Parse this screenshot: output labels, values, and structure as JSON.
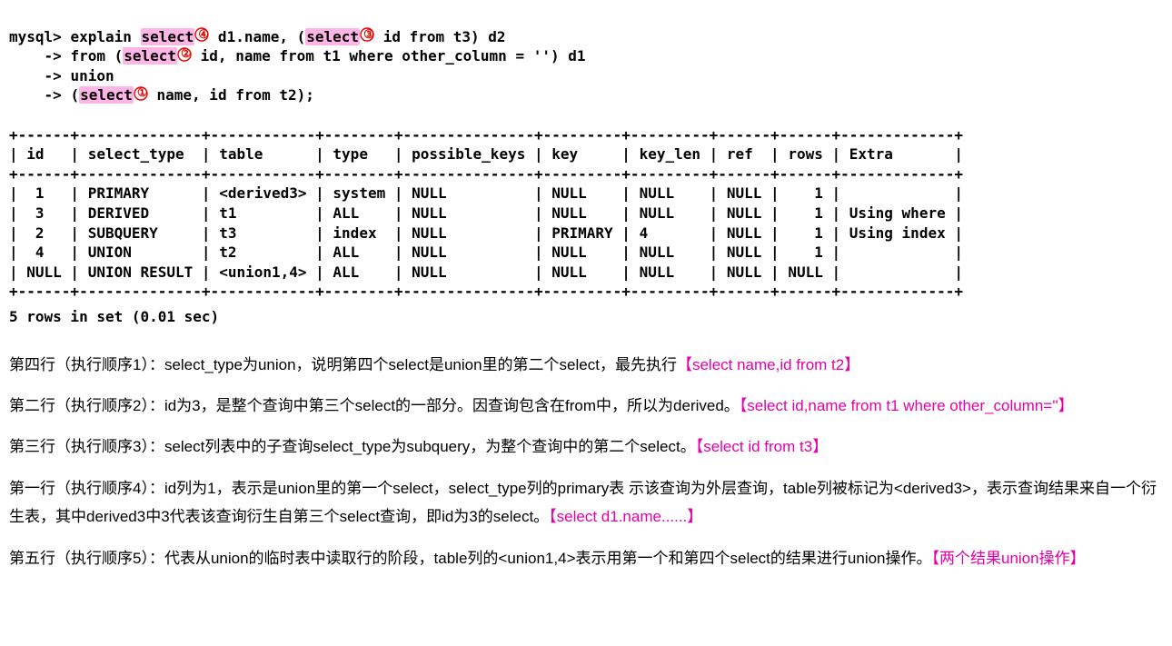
{
  "sql": {
    "prompt": "mysql> ",
    "l1a": "explain ",
    "l1_sel1": "select",
    "l1b": " d1.name, (",
    "l1_sel2": "select",
    "l1c": " id from t3) d2",
    "cont": "    -> ",
    "l2a": "from (",
    "l2_sel": "select",
    "l2b": " id, name from t1 where other_column = '') d1",
    "l3": "union",
    "l4a": "(",
    "l4_sel": "select",
    "l4b": " name, id from t2);",
    "ann4": "④",
    "ann3": "③",
    "ann2": "②",
    "ann1": "①"
  },
  "table": {
    "border_top": "+------+--------------+------------+--------+---------------+---------+---------+------+------+-------------+",
    "header": "| id   | select_type  | table      | type   | possible_keys | key     | key_len | ref  | rows | Extra       |",
    "border_mid": "+------+--------------+------------+--------+---------------+---------+---------+------+------+-------------+",
    "row1": "|  1   | PRIMARY      | <derived3> | system | NULL          | NULL    | NULL    | NULL |    1 |             |",
    "row2": "|  3   | DERIVED      | t1         | ALL    | NULL          | NULL    | NULL    | NULL |    1 | Using where |",
    "row3": "|  2   | SUBQUERY     | t3         | index  | NULL          | PRIMARY | 4       | NULL |    1 | Using index |",
    "row4": "|  4   | UNION        | t2         | ALL    | NULL          | NULL    | NULL    | NULL |    1 |             |",
    "row5": "| NULL | UNION RESULT | <union1,4> | ALL    | NULL          | NULL    | NULL    | NULL | NULL |             |",
    "border_bot": "+------+--------------+------------+--------+---------------+---------+---------+------+------+-------------+",
    "footer": "5 rows in set (0.01 sec)"
  },
  "exp": {
    "p1a": "第四行（执行顺序1）：select_type为union，说明第四个select是union里的第二个select，最先执行",
    "p1m": "【select name,id from t2】",
    "p2a": "第二行（执行顺序2）：id为3，是整个查询中第三个select的一部分。因查询包含在from中，所以为derived。",
    "p2m": "【select id,name from t1 where other_column=''】",
    "p3a": "第三行（执行顺序3）：select列表中的子查询select_type为subquery，为整个查询中的第二个select。",
    "p3m": "【select id from t3】",
    "p4a": "第一行（执行顺序4）：id列为1，表示是union里的第一个select，select_type列的primary表 示该查询为外层查询，table列被标记为<derived3>，表示查询结果来自一个衍生表，其中derived3中3代表该查询衍生自第三个select查询，即id为3的select。",
    "p4m": "【select d1.name......】",
    "p5a": "第五行（执行顺序5）：代表从union的临时表中读取行的阶段，table列的<union1,4>表示用第一个和第四个select的结果进行union操作。",
    "p5m": "【两个结果union操作】"
  }
}
